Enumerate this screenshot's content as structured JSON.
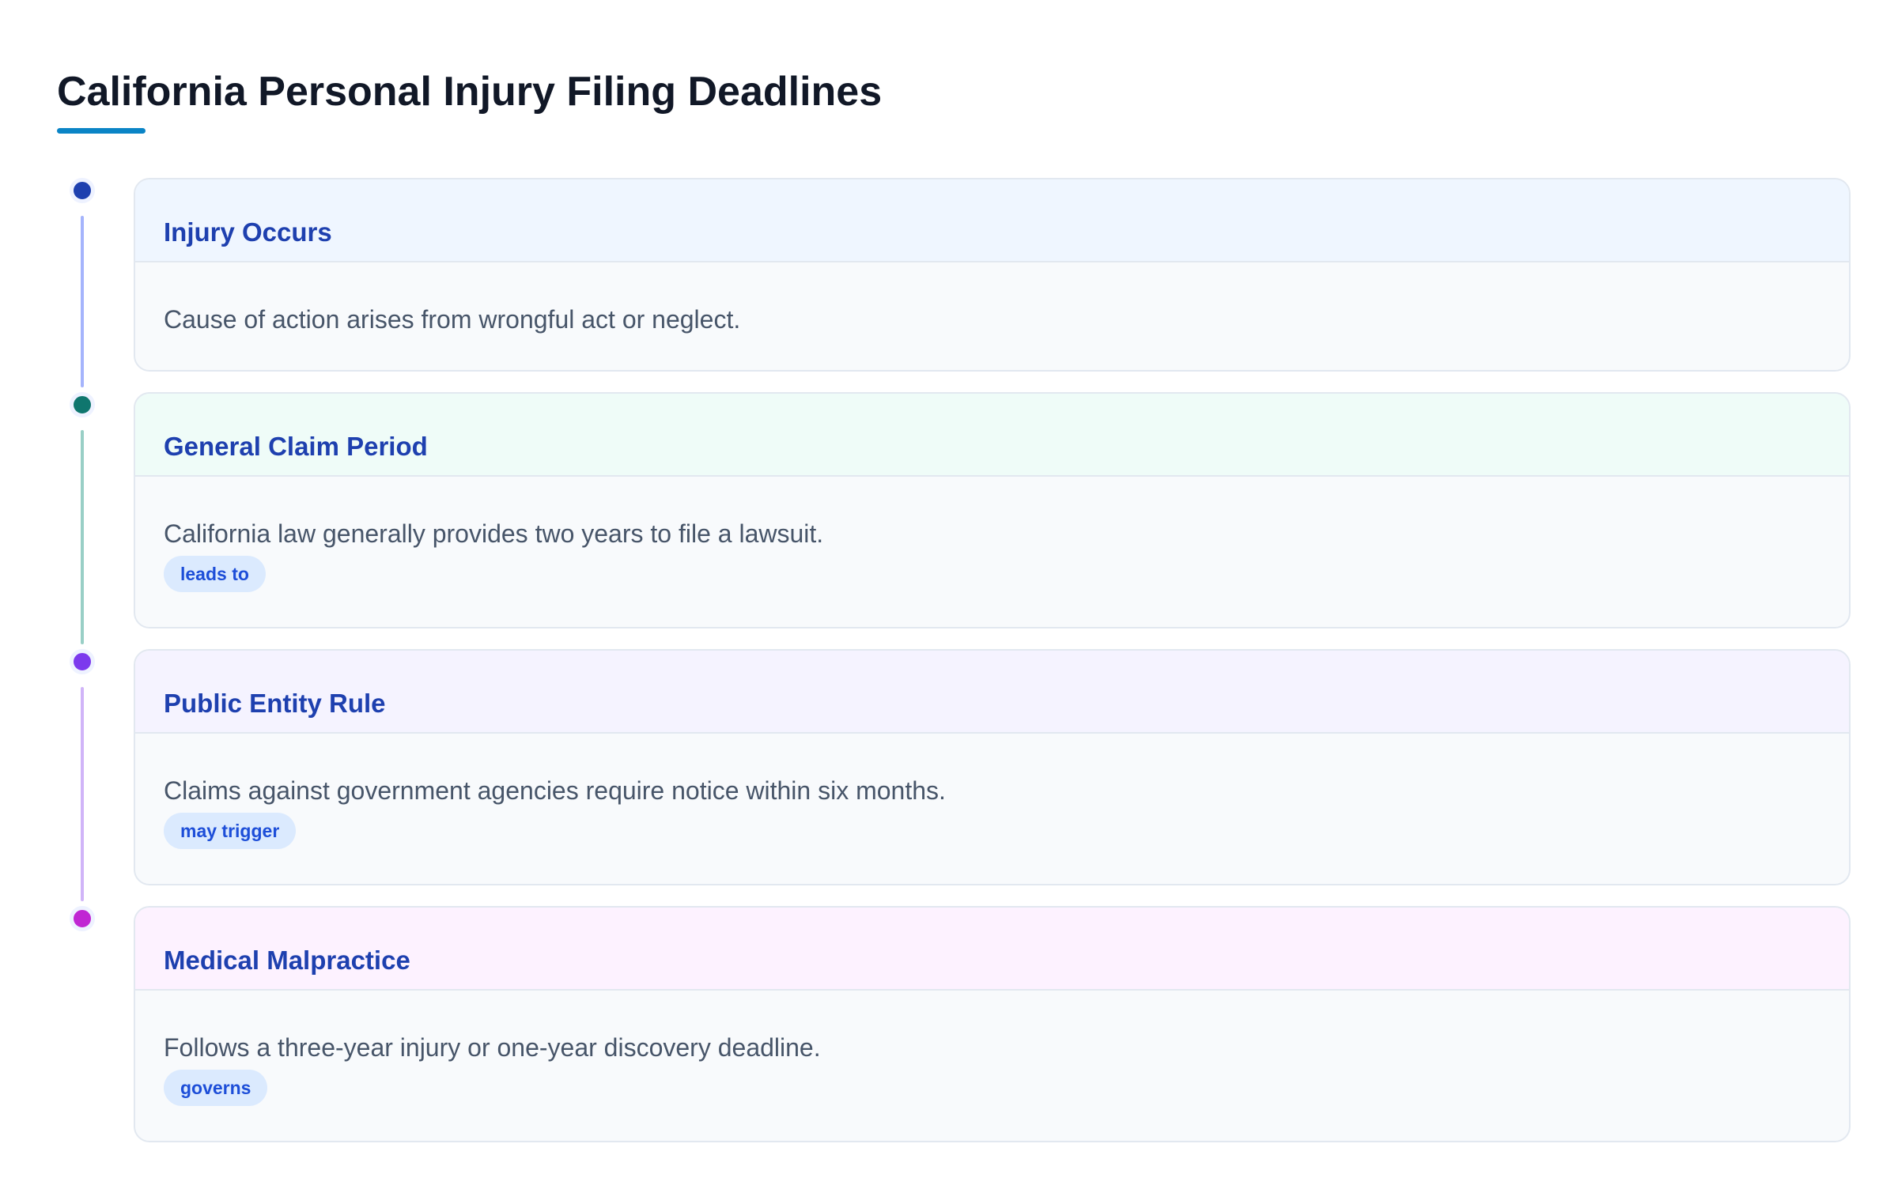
{
  "page": {
    "title": "California Personal Injury Filing Deadlines",
    "accent_color": "#0a84c6"
  },
  "steps": [
    {
      "title": "Injury Occurs",
      "text": "Cause of action arises from wrongful act or neglect.",
      "tag": "",
      "dot_color": "#1e40af",
      "line_color": "#a5b4fc",
      "header_bg": "#eff6ff"
    },
    {
      "title": "General Claim Period",
      "text": "California law generally provides two years to file a lawsuit.",
      "tag": "leads to",
      "dot_color": "#0f766e",
      "line_color": "#99cfc6",
      "header_bg": "#effcf8"
    },
    {
      "title": "Public Entity Rule",
      "text": "Claims against government agencies require notice within six months.",
      "tag": "may trigger",
      "dot_color": "#7c3aed",
      "line_color": "#d0b4f8",
      "header_bg": "#f5f3ff"
    },
    {
      "title": "Medical Malpractice",
      "text": "Follows a three-year injury or one-year discovery deadline.",
      "tag": "governs",
      "dot_color": "#c026d3",
      "line_color": "",
      "header_bg": "#fdf2ff"
    }
  ]
}
